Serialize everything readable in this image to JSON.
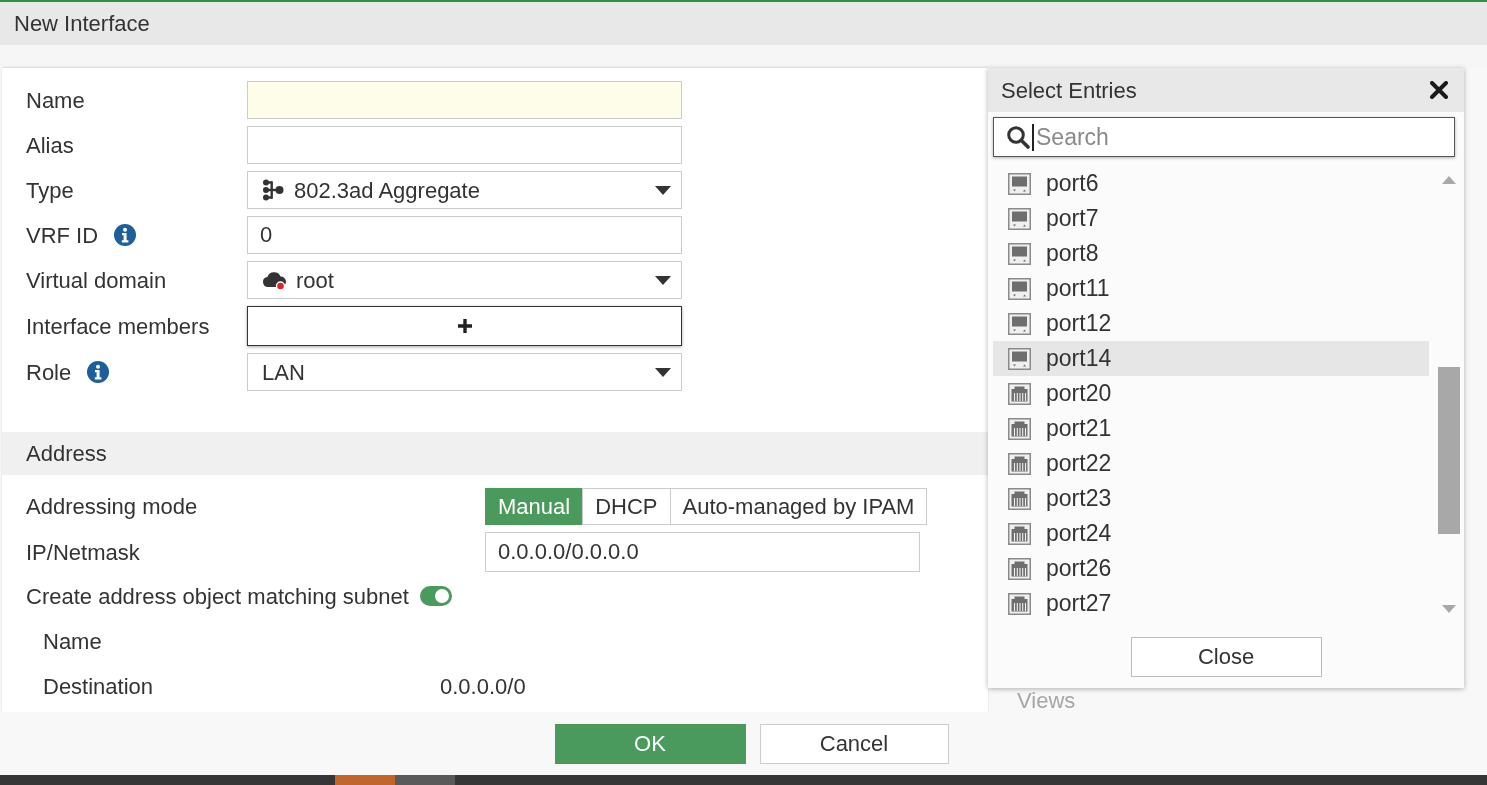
{
  "window": {
    "title": "New Interface"
  },
  "form": {
    "name": {
      "label": "Name",
      "highlighted": true
    },
    "alias": {
      "label": "Alias",
      "highlighted": false
    },
    "type": {
      "label": "Type",
      "value": "802.3ad Aggregate"
    },
    "vrf_id": {
      "label": "VRF ID",
      "value": "0"
    },
    "virtual_domain": {
      "label": "Virtual domain",
      "value": "root"
    },
    "interface_members": {
      "label": "Interface members",
      "focused": true
    },
    "role": {
      "label": "Role",
      "value": "LAN"
    }
  },
  "address": {
    "title": "Address",
    "addressing_mode": {
      "label": "Addressing mode",
      "options": [
        {
          "label": "Manual",
          "selected": true
        },
        {
          "label": "DHCP",
          "selected": false
        },
        {
          "label": "Auto-managed by IPAM",
          "selected": false
        }
      ]
    },
    "ip_netmask": {
      "label": "IP/Netmask",
      "value": "0.0.0.0/0.0.0.0"
    },
    "create_address_object": {
      "label": "Create address object matching subnet",
      "on": true
    },
    "name": {
      "label": "Name"
    },
    "destination": {
      "label": "Destination",
      "value": "0.0.0.0/0"
    }
  },
  "buttons": [
    {
      "label": "OK",
      "kind": "primary"
    },
    {
      "label": "Cancel",
      "kind": "secondary"
    }
  ],
  "select_entries": {
    "title": "Select Entries",
    "search": {
      "placeholder": "Search",
      "focused": true
    },
    "items": [
      {
        "label": "port6",
        "kind": "module",
        "selected": false
      },
      {
        "label": "port7",
        "kind": "module",
        "selected": false
      },
      {
        "label": "port8",
        "kind": "module",
        "selected": false
      },
      {
        "label": "port11",
        "kind": "module",
        "selected": false
      },
      {
        "label": "port12",
        "kind": "module",
        "selected": false
      },
      {
        "label": "port14",
        "kind": "module",
        "selected": true
      },
      {
        "label": "port20",
        "kind": "jack",
        "selected": false
      },
      {
        "label": "port21",
        "kind": "jack",
        "selected": false
      },
      {
        "label": "port22",
        "kind": "jack",
        "selected": false
      },
      {
        "label": "port23",
        "kind": "jack",
        "selected": false
      },
      {
        "label": "port24",
        "kind": "jack",
        "selected": false
      },
      {
        "label": "port26",
        "kind": "jack",
        "selected": false
      },
      {
        "label": "port27",
        "kind": "jack",
        "selected": false
      }
    ],
    "close_button": "Close"
  },
  "background": {
    "label": "Views"
  },
  "taskbar": {
    "items": [
      {
        "color": "#c0652b"
      },
      {
        "color": "#5a5a5a"
      }
    ]
  }
}
